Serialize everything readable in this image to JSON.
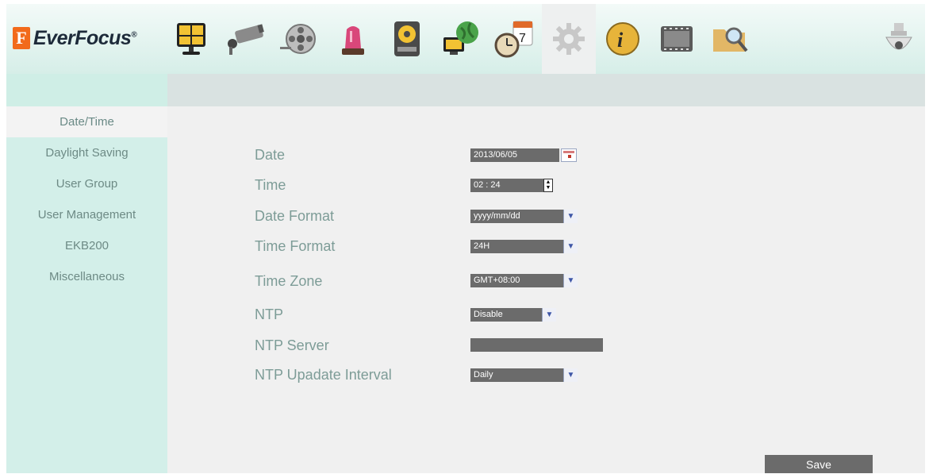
{
  "brand": {
    "mark": "F",
    "name": "EverFocus",
    "reg": "®"
  },
  "toolbar": {
    "icons": [
      "monitor-layout-icon",
      "camera-icon",
      "film-reel-icon",
      "alarm-light-icon",
      "hard-disk-icon",
      "network-globe-icon",
      "schedule-clock-icon",
      "settings-gear-icon",
      "info-icon",
      "video-strip-icon",
      "search-folder-icon",
      "dome-camera-icon"
    ],
    "active": "settings-gear-icon"
  },
  "sidebar": {
    "items": [
      {
        "label": "Date/Time",
        "active": true
      },
      {
        "label": "Daylight Saving"
      },
      {
        "label": "User Group"
      },
      {
        "label": "User Management"
      },
      {
        "label": "EKB200"
      },
      {
        "label": "Miscellaneous"
      }
    ]
  },
  "form": {
    "date": {
      "label": "Date",
      "value": "2013/06/05"
    },
    "time": {
      "label": "Time",
      "value": "02 : 24"
    },
    "date_format": {
      "label": "Date Format",
      "value": "yyyy/mm/dd"
    },
    "time_format": {
      "label": "Time Format",
      "value": "24H"
    },
    "time_zone": {
      "label": "Time Zone",
      "value": "GMT+08:00"
    },
    "ntp": {
      "label": "NTP",
      "value": "Disable"
    },
    "ntp_server": {
      "label": "NTP Server",
      "value": ""
    },
    "ntp_interval": {
      "label": "NTP Upadate Interval",
      "value": "Daily"
    }
  },
  "actions": {
    "save_label": "Save"
  },
  "colors": {
    "accent": "#f26a1b",
    "sidebar": "#d3efe9",
    "control": "#6b6b6b",
    "label": "#7d9c97"
  }
}
